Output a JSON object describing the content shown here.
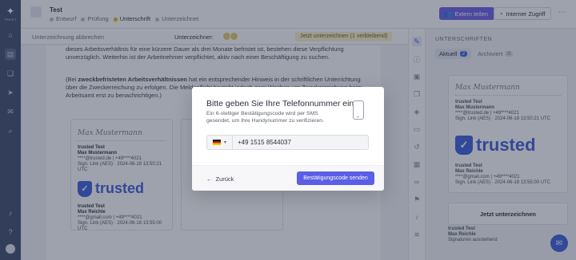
{
  "rail": {
    "logo_text": "TRUST",
    "icons": [
      "home-icon",
      "document-icon",
      "templates-icon",
      "send-icon",
      "inbox-icon",
      "search-icon"
    ],
    "bottom_icons": [
      "bell-icon",
      "help-icon",
      "avatar"
    ]
  },
  "header": {
    "title": "Test",
    "steps": [
      "Entwurf",
      "Prüfung",
      "Unterschrift",
      "Unterzeichnet"
    ],
    "current_step": "Unterschrift",
    "team_button": "Extern teilen",
    "access_button": "Interner Zugriff"
  },
  "subbar": {
    "back_label": "Unterzeichnung abbrechen",
    "signers_label": "Unterzeichner:",
    "sign_now_label": "Jetzt unterzeichnen (1 verbleibend)"
  },
  "document": {
    "para1": "dieses Arbeitsverhältnis für eine kürzere Dauer als drei Monate befristet ist, bestehen diese Verpflichtung unverzüglich. Weiterhin ist der Arbeitnehmer verpflichtet, aktiv nach einer Beschäftigung zu suchen.",
    "para2_prefix": "(Bei ",
    "para2_bold": "zweckbefristeten Arbeitsverhältnissen",
    "para2_rest": " hat ein entsprechender Hinweis in der schriftlichen Unterrichtung über die Zweckerreichung zu erfolgen. Die Meldepflicht besteht jedoch zwei Wochen vor Zweckerreichung beim Arbeitsamt erst zu benachrichtigen.)",
    "sig1": {
      "script": "Max Mustermann",
      "company": "trusted Test",
      "name": "Max Mustermann",
      "contact": "****@trusted.de | +49****4021",
      "date": "Sign. Link (AES) · 2024-06-18 13:50:21 UTC"
    },
    "sig2": {
      "trusted_label": "trusted",
      "company": "trusted Test",
      "name": "Max Reichle",
      "contact": "****@gmail.com | +49****4021",
      "date": "Sign. Link (AES) · 2024-06-18 13:55:00 UTC"
    }
  },
  "right_panel": {
    "heading": "UNTERSCHRIFTEN",
    "tab_active": "Aktuell",
    "tab_active_count": "2",
    "tab_inactive": "Archiviert",
    "tab_inactive_count": "0",
    "card1": {
      "script": "Max Mustermann",
      "company": "trusted Test",
      "name": "Max Mustermann",
      "contact": "****@trusted.de | +49****4021",
      "date": "Sign. Link (AES) · 2024-06-18 13:50:21 UTC"
    },
    "card2": {
      "trusted_label": "trusted",
      "company": "trusted Test",
      "name": "Max Reichle",
      "contact": "****@gmail.com | +49****4021",
      "date": "Sign. Link (AES) · 2024-06-18 13:55:00 UTC"
    },
    "sign_now_button": "Jetzt unterzeichnen",
    "pending": {
      "company": "trusted Test",
      "name": "Max Reichle",
      "contact": "Signaturen ausstehend"
    }
  },
  "modal": {
    "title": "Bitte geben Sie Ihre Telefonnummer ein",
    "description": "Ein 6-stelliger Bestätigungscode wird per SMS gesendet, um Ihre Handynummer zu verifizieren.",
    "phone_value": "+49 1515 8544037",
    "country_flag": "flag-de",
    "back_label": "Zurück",
    "send_label": "Bestätigungscode senden"
  }
}
